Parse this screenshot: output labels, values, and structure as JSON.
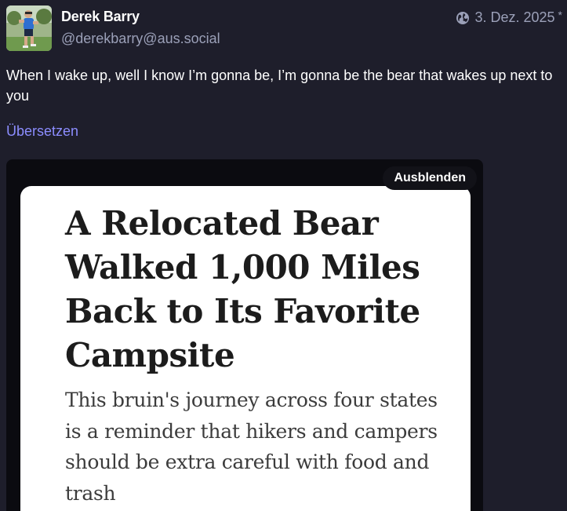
{
  "post": {
    "author": {
      "display_name": "Derek Barry",
      "handle": "@derekbarry@aus.social",
      "avatar_icon": "avatar-runner-photo"
    },
    "visibility_icon": "globe-icon",
    "date": "3. Dez. 2025",
    "edited_marker": "*",
    "text": "When I wake up, well I know I’m gonna be, I’m gonna be the bear that wakes up next to you",
    "translate_label": "Übersetzen",
    "translate_color": "#8c8dff"
  },
  "media": {
    "hide_label": "Ausblenden",
    "headline": "A Relocated Bear Walked 1,000 Miles Back to Its Favorite Campsite",
    "subheadline": "This bruin's journey across four states is a reminder that hikers and campers should be extra careful with food and trash"
  }
}
